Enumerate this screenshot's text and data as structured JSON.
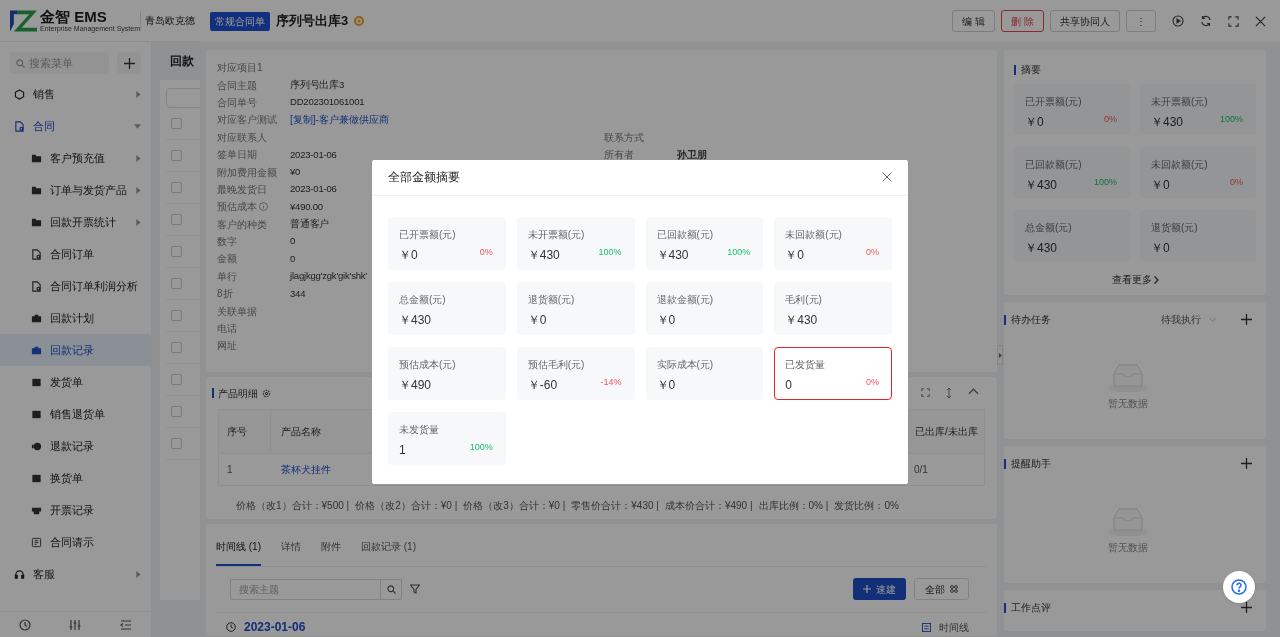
{
  "header": {
    "logo": {
      "name": "金智 EMS",
      "tagline": "Enterprise Management System"
    },
    "company": "青岛欧克德"
  },
  "sidebar": {
    "search": {
      "placeholder": "搜索菜单"
    },
    "items": [
      {
        "label": "销售",
        "expanded": false
      },
      {
        "label": "合同",
        "expanded": true,
        "children": [
          {
            "label": "客户预充值",
            "has_children": true,
            "selected": false
          },
          {
            "label": "订单与发货产品",
            "has_children": true,
            "selected": false
          },
          {
            "label": "回款开票统计",
            "has_children": true,
            "selected": false
          },
          {
            "label": "合同订单",
            "has_children": false,
            "selected": false
          },
          {
            "label": "合同订单利润分析",
            "has_children": false,
            "selected": false
          },
          {
            "label": "回款计划",
            "has_children": false,
            "selected": false
          },
          {
            "label": "回款记录",
            "has_children": false,
            "selected": true
          },
          {
            "label": "发货单",
            "has_children": false,
            "selected": false
          },
          {
            "label": "销售退货单",
            "has_children": false,
            "selected": false
          },
          {
            "label": "退款记录",
            "has_children": false,
            "selected": false
          },
          {
            "label": "换货单",
            "has_children": false,
            "selected": false
          },
          {
            "label": "开票记录",
            "has_children": false,
            "selected": false
          },
          {
            "label": "合同请示",
            "has_children": false,
            "selected": false
          }
        ]
      },
      {
        "label": "客服",
        "expanded": false
      }
    ]
  },
  "list_page": {
    "title": "回款",
    "checkboxes": [
      {
        "checked": false
      },
      {
        "checked": false
      },
      {
        "checked": false
      },
      {
        "checked": false
      },
      {
        "checked": false
      },
      {
        "checked": false
      },
      {
        "checked": false
      },
      {
        "checked": false
      },
      {
        "checked": false
      },
      {
        "checked": false
      },
      {
        "checked": false
      }
    ]
  },
  "drawer": {
    "tag": "常规合同单",
    "title": "序列号出库3",
    "actions": [
      {
        "label": "编 辑",
        "kind": "default"
      },
      {
        "label": "删 除",
        "kind": "danger"
      },
      {
        "label": "共享协同人",
        "kind": "default"
      },
      {
        "label": "⋮",
        "kind": "default"
      }
    ],
    "details": [
      {
        "label": "对应项目1",
        "info": false
      },
      {
        "label": "合同主题",
        "value": "序列号出库3",
        "kind": "text",
        "info": false
      },
      {
        "label": "合同单号",
        "value": "DD202301061001",
        "kind": "text",
        "info": false
      },
      {
        "label": "对应客户测试",
        "value": "[复制]-客户兼做供应商",
        "kind": "link",
        "info": false
      },
      {
        "label": "对应联系人",
        "info": false
      },
      {
        "label": "签单日期",
        "value": "2023-01-06",
        "kind": "text",
        "info": false
      },
      {
        "label": "附加费用金额",
        "value": "¥0",
        "kind": "text",
        "info": false
      },
      {
        "label": "最晚发货日",
        "value": "2023-01-06",
        "kind": "text",
        "info": false
      },
      {
        "label": "预估成本",
        "value": "¥490.00",
        "kind": "text",
        "info": true
      },
      {
        "label": "客户的种类",
        "value": "普通客户",
        "kind": "text",
        "info": false
      },
      {
        "label": "数字",
        "value": "0",
        "kind": "text",
        "info": false
      },
      {
        "label": "金额",
        "value": "0",
        "kind": "text",
        "info": false
      },
      {
        "label": "单行",
        "value": "jlagjkgg'zgk'gik'shk'",
        "kind": "text",
        "info": false
      },
      {
        "label": "8折",
        "value": "344",
        "kind": "text",
        "info": false
      },
      {
        "label": "关联单据",
        "info": false
      },
      {
        "label": "电话",
        "info": false
      },
      {
        "label": "网址",
        "info": false
      }
    ],
    "side_details": [
      {
        "label": "联系方式"
      },
      {
        "label": "所有者",
        "value": "孙卫朋"
      }
    ],
    "products": {
      "title": "产品明细",
      "columns": [
        "序号",
        "产品名称",
        "已出库/未出库"
      ],
      "rows": [
        [
          "1",
          "茶杯犬挂件",
          "0/1"
        ]
      ],
      "totals": [
        "价格（改1）合计：¥500 |",
        "价格（改2）合计：¥0 |",
        "价格（改3）合计：¥0 |",
        "零售价合计：¥430 |",
        "成本价合计：¥490 |",
        "出库比例：0% |",
        "发货比例：0%"
      ]
    },
    "timeline": {
      "tabs": [
        {
          "label": "时间线 (1)",
          "selected": true
        },
        {
          "label": "详情",
          "selected": false
        },
        {
          "label": "附件",
          "selected": false
        },
        {
          "label": "回款记录 (1)",
          "selected": false
        }
      ],
      "search": {
        "placeholder": "搜索主题"
      },
      "quick_button": "速建",
      "all_button": "全部",
      "date": "2023-01-06",
      "view": "时间线"
    },
    "summary": {
      "title": "摘要",
      "tiles": [
        {
          "label": "已开票额(元)",
          "value": "￥0",
          "percent": "0%",
          "positive": false
        },
        {
          "label": "未开票额(元)",
          "value": "￥430",
          "percent": "100%",
          "positive": true
        },
        {
          "label": "已回款额(元)",
          "value": "￥430",
          "percent": "100%",
          "positive": true
        },
        {
          "label": "未回款额(元)",
          "value": "￥0",
          "percent": "0%",
          "positive": false
        },
        {
          "label": "总金额(元)",
          "value": "￥430"
        },
        {
          "label": "退货额(元)",
          "value": "￥0"
        }
      ],
      "more": "查看更多"
    },
    "tasks": {
      "title": "待办任务",
      "filter": "待我执行",
      "empty": "暂无数据"
    },
    "reminders": {
      "title": "提醒助手",
      "empty": "暂无数据"
    },
    "reviews": {
      "title": "工作点评"
    }
  },
  "modal": {
    "title": "全部金额摘要",
    "tiles": [
      {
        "label": "已开票额(元)",
        "value": "￥0",
        "percent": "0%",
        "positive": false,
        "highlighted": false
      },
      {
        "label": "未开票额(元)",
        "value": "￥430",
        "percent": "100%",
        "positive": true,
        "highlighted": false
      },
      {
        "label": "已回款额(元)",
        "value": "￥430",
        "percent": "100%",
        "positive": true,
        "highlighted": false
      },
      {
        "label": "未回款额(元)",
        "value": "￥0",
        "percent": "0%",
        "positive": false,
        "highlighted": false
      },
      {
        "label": "总金额(元)",
        "value": "￥430",
        "highlighted": false
      },
      {
        "label": "退货额(元)",
        "value": "￥0",
        "highlighted": false
      },
      {
        "label": "退款金额(元)",
        "value": "￥0",
        "highlighted": false
      },
      {
        "label": "毛利(元)",
        "value": "￥430",
        "highlighted": false
      },
      {
        "label": "预估成本(元)",
        "value": "￥490",
        "highlighted": false
      },
      {
        "label": "预估毛利(元)",
        "value": "￥-60",
        "percent": "-14%",
        "positive": false,
        "highlighted": false
      },
      {
        "label": "实际成本(元)",
        "value": "￥0",
        "highlighted": false
      },
      {
        "label": "已发货量",
        "value": "0",
        "percent": "0%",
        "positive": false,
        "highlighted": true
      },
      {
        "label": "未发货量",
        "value": "1",
        "percent": "100%",
        "positive": true,
        "highlighted": false
      }
    ]
  }
}
